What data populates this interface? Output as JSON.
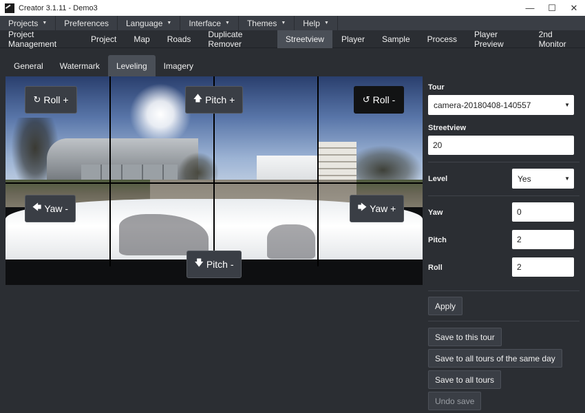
{
  "window": {
    "title": "Creator 3.1.11 - Demo3",
    "minimize": "—",
    "maximize": "☐",
    "close": "✕"
  },
  "menu": {
    "items": [
      {
        "label": "Projects",
        "caret": true
      },
      {
        "label": "Preferences",
        "caret": false
      },
      {
        "label": "Language",
        "caret": true
      },
      {
        "label": "Interface",
        "caret": true
      },
      {
        "label": "Themes",
        "caret": true
      },
      {
        "label": "Help",
        "caret": true
      }
    ]
  },
  "tabs": {
    "items": [
      "Project Management",
      "Project",
      "Map",
      "Roads",
      "Duplicate Remover",
      "Streetview",
      "Player",
      "Sample",
      "Process",
      "Player Preview",
      "2nd Monitor"
    ],
    "active": "Streetview"
  },
  "subtabs": {
    "items": [
      "General",
      "Watermark",
      "Leveling",
      "Imagery"
    ],
    "active": "Leveling"
  },
  "panorama": {
    "roll_plus": "Roll +",
    "pitch_plus": "Pitch +",
    "roll_minus": "Roll -",
    "yaw_minus": "Yaw -",
    "yaw_plus": "Yaw +",
    "pitch_minus": "Pitch -"
  },
  "panel": {
    "tour_label": "Tour",
    "tour_value": "camera-20180408-140557",
    "streetview_label": "Streetview",
    "streetview_value": "20",
    "level_label": "Level",
    "level_value": "Yes",
    "yaw_label": "Yaw",
    "yaw_value": "0",
    "pitch_label": "Pitch",
    "pitch_value": "2",
    "roll_label": "Roll",
    "roll_value": "2",
    "apply": "Apply",
    "save_tour": "Save to this tour",
    "save_same_day": "Save to all tours of the same day",
    "save_all": "Save to all tours",
    "undo_save": "Undo save"
  }
}
